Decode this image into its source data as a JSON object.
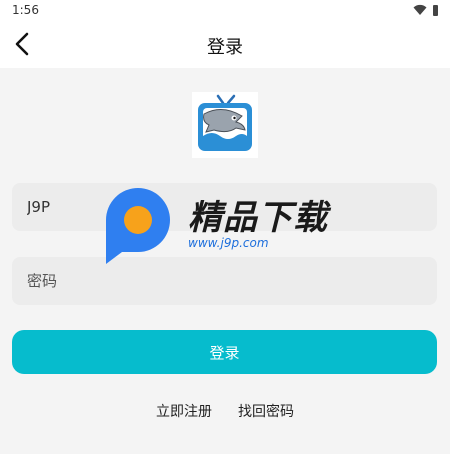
{
  "status": {
    "time": "1:56"
  },
  "header": {
    "title": "登录"
  },
  "form": {
    "username_value": "J9P",
    "password_placeholder": "密码"
  },
  "actions": {
    "login_label": "登录",
    "register_label": "立即注册",
    "forgot_label": "找回密码"
  },
  "watermark": {
    "text": "精品下载",
    "url": "www.j9p.com"
  },
  "colors": {
    "accent": "#06bccd",
    "field_bg": "#ececec",
    "page_bg": "#f4f4f4"
  },
  "icons": {
    "back": "chevron-left-icon",
    "wifi": "wifi-icon",
    "battery": "battery-icon",
    "logo": "shark-tv-logo"
  }
}
